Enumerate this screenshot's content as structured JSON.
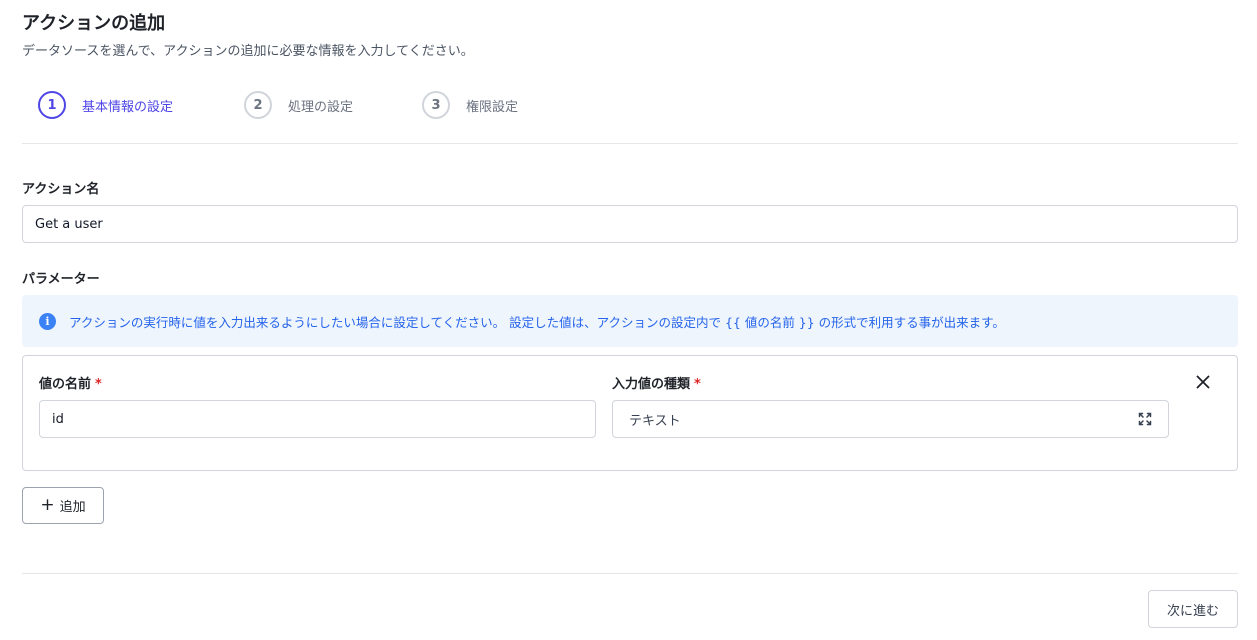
{
  "header": {
    "title": "アクションの追加",
    "subtitle": "データソースを選んで、アクションの追加に必要な情報を入力してください。"
  },
  "steps": [
    {
      "number": "1",
      "label": "基本情報の設定",
      "active": true
    },
    {
      "number": "2",
      "label": "処理の設定",
      "active": false
    },
    {
      "number": "3",
      "label": "権限設定",
      "active": false
    }
  ],
  "action_name": {
    "label": "アクション名",
    "value": "Get a user"
  },
  "parameters": {
    "label": "パラメーター",
    "info_text": "アクションの実行時に値を入力出来るようにしたい場合に設定してください。 設定した値は、アクションの設定内で {{ 値の名前 }} の形式で利用する事が出来ます。",
    "items": [
      {
        "name_label": "値の名前",
        "name_value": "id",
        "type_label": "入力値の種類",
        "type_value": "テキスト",
        "required_mark": "*"
      }
    ],
    "add_label": "追加"
  },
  "footer": {
    "next_label": "次に進む"
  },
  "colors": {
    "accent": "#4f46e5",
    "info_bg": "#eef5fd",
    "info_text": "#2563eb",
    "required": "#dc2626"
  }
}
